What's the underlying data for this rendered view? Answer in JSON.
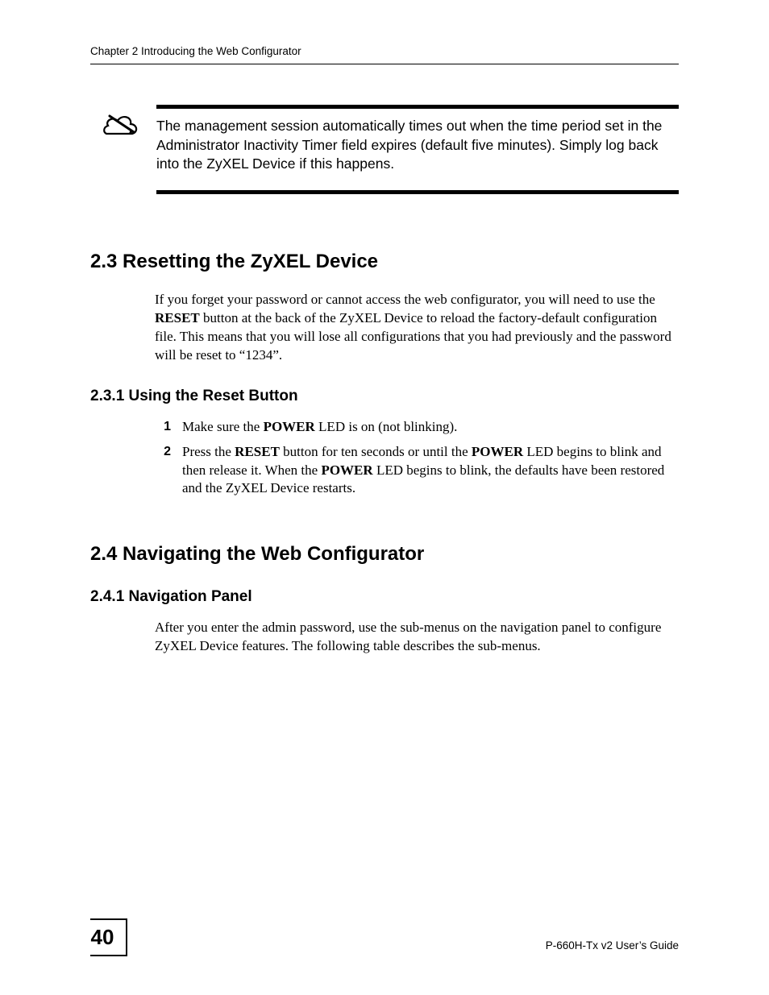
{
  "header": {
    "running_title": "Chapter 2 Introducing the Web Configurator"
  },
  "note": {
    "text": "The management session automatically times out when the time period set in the Administrator Inactivity Timer field expires (default five minutes). Simply log back into the ZyXEL Device if this happens."
  },
  "section_2_3": {
    "title": "2.3  Resetting the ZyXEL Device",
    "para_parts": {
      "p1": "If you forget your password or cannot access the web configurator, you will need to use the ",
      "b1": "RESET",
      "p2": " button at the back of the ZyXEL Device to reload the factory-default configuration file. This means that you will lose all configurations that you had previously and the password will be reset to “1234”."
    },
    "sub_2_3_1": {
      "title": "2.3.1  Using the Reset Button",
      "items": [
        {
          "num": "1",
          "parts": {
            "p1": "Make sure the ",
            "b1": "POWER",
            "p2": " LED is on (not blinking)."
          }
        },
        {
          "num": "2",
          "parts": {
            "p1": "Press the ",
            "b1": "RESET",
            "p2": " button for ten seconds or until the ",
            "b2": "POWER",
            "p3": " LED begins to blink and then release it. When the ",
            "b3": "POWER",
            "p4": " LED begins to blink, the defaults have been restored and the ZyXEL Device restarts."
          }
        }
      ]
    }
  },
  "section_2_4": {
    "title": "2.4  Navigating the Web Configurator",
    "sub_2_4_1": {
      "title": "2.4.1  Navigation Panel",
      "para": "After you enter the admin password, use the sub-menus on the navigation panel to configure ZyXEL Device features. The following table describes the sub-menus."
    }
  },
  "footer": {
    "page_number": "40",
    "guide": "P-660H-Tx v2 User’s Guide"
  }
}
